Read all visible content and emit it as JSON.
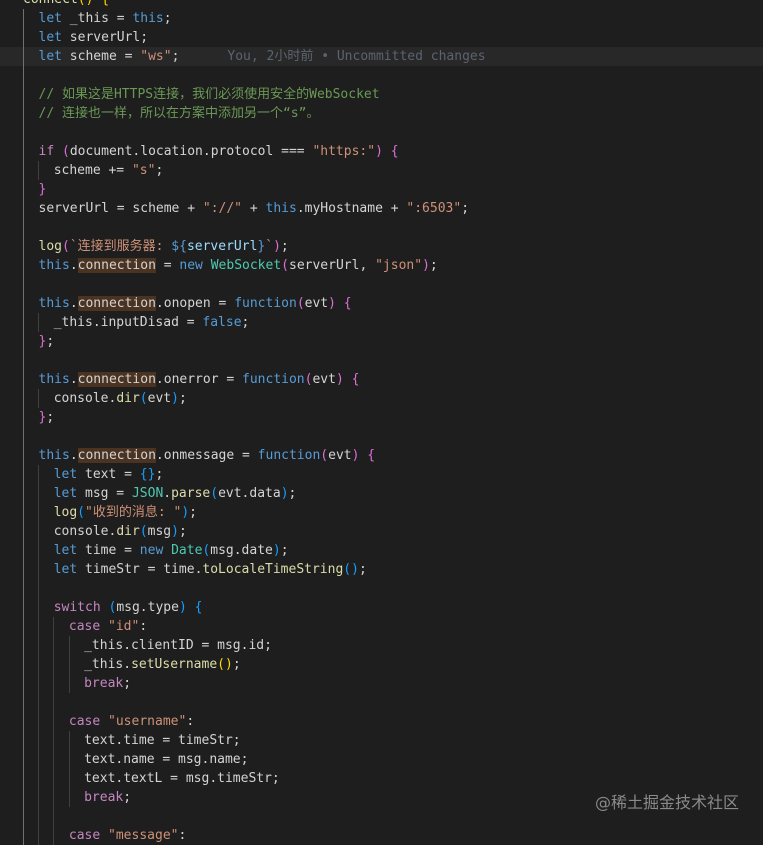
{
  "editor": {
    "lines": [
      [
        [
          "fn",
          "connect"
        ],
        [
          "b1",
          "() {"
        ]
      ],
      [
        [
          "kw",
          "let"
        ],
        [
          "t",
          " _this = "
        ],
        [
          "kw",
          "this"
        ],
        [
          "t",
          ";"
        ]
      ],
      [
        [
          "kw",
          "let"
        ],
        [
          "t",
          " serverUrl;"
        ]
      ],
      [
        [
          "kw",
          "let"
        ],
        [
          "t",
          " scheme = "
        ],
        [
          "str",
          "\"ws\""
        ],
        [
          "t",
          ";"
        ]
      ],
      [],
      [
        [
          "com",
          "// 如果这是HTTPS连接，我们必须使用安全的WebSocket"
        ]
      ],
      [
        [
          "com",
          "// 连接也一样，所以在方案中添加另一个“s”。"
        ]
      ],
      [],
      [
        [
          "ctl",
          "if"
        ],
        [
          "t",
          " "
        ],
        [
          "b2",
          "("
        ],
        [
          "t",
          "document.location.protocol === "
        ],
        [
          "str",
          "\"https:\""
        ],
        [
          "b2",
          ")"
        ],
        [
          "t",
          " "
        ],
        [
          "b2",
          "{"
        ]
      ],
      [
        [
          "t",
          "scheme += "
        ],
        [
          "str",
          "\"s\""
        ],
        [
          "t",
          ";"
        ]
      ],
      [
        [
          "b2",
          "}"
        ]
      ],
      [
        [
          "t",
          "serverUrl = scheme + "
        ],
        [
          "str",
          "\"://\""
        ],
        [
          "t",
          " + "
        ],
        [
          "kw",
          "this"
        ],
        [
          "t",
          ".myHostname + "
        ],
        [
          "str",
          "\":6503\""
        ],
        [
          "t",
          ";"
        ]
      ],
      [],
      [
        [
          "fn",
          "log"
        ],
        [
          "b2",
          "("
        ],
        [
          "str",
          "`连接到服务器: "
        ],
        [
          "kw",
          "${"
        ],
        [
          "var",
          "serverUrl"
        ],
        [
          "kw",
          "}"
        ],
        [
          "str",
          "`"
        ],
        [
          "b2",
          ")"
        ],
        [
          "t",
          ";"
        ]
      ],
      [
        [
          "kw",
          "this"
        ],
        [
          "t",
          "."
        ],
        [
          "hl",
          "connection"
        ],
        [
          "t",
          " = "
        ],
        [
          "kw",
          "new"
        ],
        [
          "t",
          " "
        ],
        [
          "cls",
          "WebSocket"
        ],
        [
          "b2",
          "("
        ],
        [
          "t",
          "serverUrl, "
        ],
        [
          "str",
          "\"json\""
        ],
        [
          "b2",
          ")"
        ],
        [
          "t",
          ";"
        ]
      ],
      [],
      [
        [
          "kw",
          "this"
        ],
        [
          "t",
          "."
        ],
        [
          "hl",
          "connection"
        ],
        [
          "t",
          ".onopen = "
        ],
        [
          "kw",
          "function"
        ],
        [
          "b2",
          "("
        ],
        [
          "t",
          "evt"
        ],
        [
          "b2",
          ")"
        ],
        [
          "t",
          " "
        ],
        [
          "b2",
          "{"
        ]
      ],
      [
        [
          "t",
          "_this.inputDisad = "
        ],
        [
          "kw",
          "false"
        ],
        [
          "t",
          ";"
        ]
      ],
      [
        [
          "b2",
          "}"
        ],
        [
          "t",
          ";"
        ]
      ],
      [],
      [
        [
          "kw",
          "this"
        ],
        [
          "t",
          "."
        ],
        [
          "hl",
          "connection"
        ],
        [
          "t",
          ".onerror = "
        ],
        [
          "kw",
          "function"
        ],
        [
          "b2",
          "("
        ],
        [
          "t",
          "evt"
        ],
        [
          "b2",
          ")"
        ],
        [
          "t",
          " "
        ],
        [
          "b2",
          "{"
        ]
      ],
      [
        [
          "t",
          "console."
        ],
        [
          "fn",
          "dir"
        ],
        [
          "b3",
          "("
        ],
        [
          "t",
          "evt"
        ],
        [
          "b3",
          ")"
        ],
        [
          "t",
          ";"
        ]
      ],
      [
        [
          "b2",
          "}"
        ],
        [
          "t",
          ";"
        ]
      ],
      [],
      [
        [
          "kw",
          "this"
        ],
        [
          "t",
          "."
        ],
        [
          "hl",
          "connection"
        ],
        [
          "t",
          ".onmessage = "
        ],
        [
          "kw",
          "function"
        ],
        [
          "b2",
          "("
        ],
        [
          "t",
          "evt"
        ],
        [
          "b2",
          ")"
        ],
        [
          "t",
          " "
        ],
        [
          "b2",
          "{"
        ]
      ],
      [
        [
          "kw",
          "let"
        ],
        [
          "t",
          " text = "
        ],
        [
          "b3",
          "{}"
        ],
        [
          "t",
          ";"
        ]
      ],
      [
        [
          "kw",
          "let"
        ],
        [
          "t",
          " msg = "
        ],
        [
          "cls",
          "JSON"
        ],
        [
          "t",
          "."
        ],
        [
          "fn",
          "parse"
        ],
        [
          "b3",
          "("
        ],
        [
          "t",
          "evt.data"
        ],
        [
          "b3",
          ")"
        ],
        [
          "t",
          ";"
        ]
      ],
      [
        [
          "fn",
          "log"
        ],
        [
          "b3",
          "("
        ],
        [
          "str",
          "\"收到的消息: \""
        ],
        [
          "b3",
          ")"
        ],
        [
          "t",
          ";"
        ]
      ],
      [
        [
          "t",
          "console."
        ],
        [
          "fn",
          "dir"
        ],
        [
          "b3",
          "("
        ],
        [
          "t",
          "msg"
        ],
        [
          "b3",
          ")"
        ],
        [
          "t",
          ";"
        ]
      ],
      [
        [
          "kw",
          "let"
        ],
        [
          "t",
          " time = "
        ],
        [
          "kw",
          "new"
        ],
        [
          "t",
          " "
        ],
        [
          "cls",
          "Date"
        ],
        [
          "b3",
          "("
        ],
        [
          "t",
          "msg.date"
        ],
        [
          "b3",
          ")"
        ],
        [
          "t",
          ";"
        ]
      ],
      [
        [
          "kw",
          "let"
        ],
        [
          "t",
          " timeStr = time."
        ],
        [
          "fn",
          "toLocaleTimeString"
        ],
        [
          "b3",
          "()"
        ],
        [
          "t",
          ";"
        ]
      ],
      [],
      [
        [
          "ctl",
          "switch"
        ],
        [
          "t",
          " "
        ],
        [
          "b3",
          "("
        ],
        [
          "t",
          "msg.type"
        ],
        [
          "b3",
          ")"
        ],
        [
          "t",
          " "
        ],
        [
          "b3",
          "{"
        ]
      ],
      [
        [
          "ctl",
          "case"
        ],
        [
          "t",
          " "
        ],
        [
          "str",
          "\"id\""
        ],
        [
          "t",
          ":"
        ]
      ],
      [
        [
          "t",
          "_this.clientID = msg.id;"
        ]
      ],
      [
        [
          "t",
          "_this."
        ],
        [
          "fn",
          "setUsername"
        ],
        [
          "b1",
          "()"
        ],
        [
          "t",
          ";"
        ]
      ],
      [
        [
          "ctl",
          "break"
        ],
        [
          "t",
          ";"
        ]
      ],
      [],
      [
        [
          "ctl",
          "case"
        ],
        [
          "t",
          " "
        ],
        [
          "str",
          "\"username\""
        ],
        [
          "t",
          ":"
        ]
      ],
      [
        [
          "t",
          "text.time = timeStr;"
        ]
      ],
      [
        [
          "t",
          "text.name = msg.name;"
        ]
      ],
      [
        [
          "t",
          "text.textL = msg.timeStr;"
        ]
      ],
      [
        [
          "ctl",
          "break"
        ],
        [
          "t",
          ";"
        ]
      ],
      [],
      [
        [
          "ctl",
          "case"
        ],
        [
          "t",
          " "
        ],
        [
          "str",
          "\"message\""
        ],
        [
          "t",
          ":"
        ]
      ]
    ],
    "blame_annotation": "You, 2小时前 • Uncommitted changes"
  },
  "watermark": "@稀土掘金技术社区"
}
